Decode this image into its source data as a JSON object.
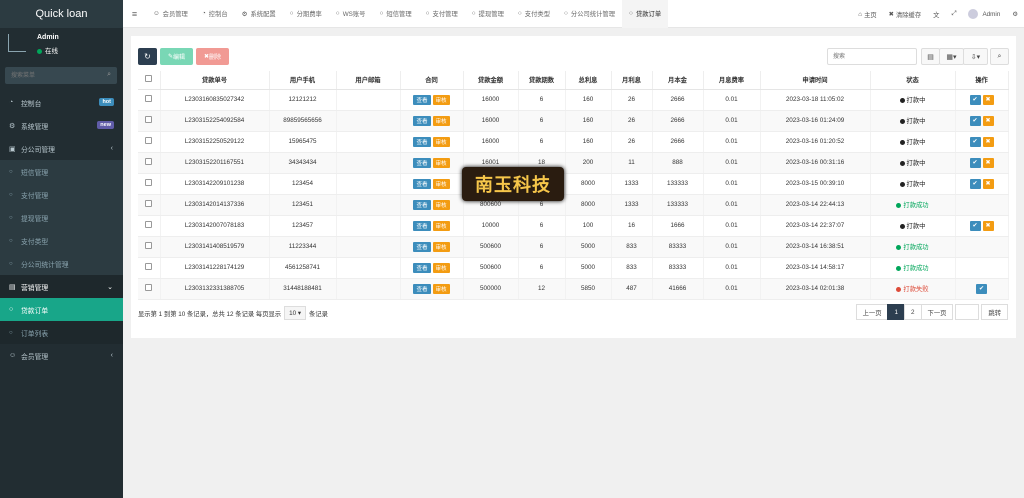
{
  "app": {
    "title": "Quick loan"
  },
  "user": {
    "name": "Admin",
    "status": "在线"
  },
  "sidebar": {
    "search_placeholder": "搜索菜单",
    "items": [
      {
        "label": "控制台",
        "icon": "dashboard-icon",
        "badge": "hot",
        "badge_color": "#3c8dbc"
      },
      {
        "label": "系统管理",
        "icon": "cogs-icon",
        "badge": "new",
        "badge_color": "#605ca8"
      },
      {
        "label": "分公司管理",
        "icon": "building-icon",
        "chevron": "‹"
      },
      {
        "label": "短信管理",
        "sub": true
      },
      {
        "label": "支付管理",
        "sub": true
      },
      {
        "label": "提现管理",
        "sub": true
      },
      {
        "label": "支付类型",
        "sub": true
      },
      {
        "label": "分公司统计管理",
        "sub": true
      },
      {
        "label": "营销管理",
        "icon": "marketing-icon",
        "open": true
      },
      {
        "label": "贷款订单",
        "sub": true,
        "active": true
      },
      {
        "label": "订单列表",
        "sub": true
      },
      {
        "label": "会员管理",
        "icon": "users-icon",
        "chevron": "‹"
      }
    ]
  },
  "topbar": {
    "tabs": [
      {
        "label": "会员管理",
        "icon": "user-icon"
      },
      {
        "label": "控制台",
        "icon": "dashboard-icon"
      },
      {
        "label": "系统配置",
        "icon": "gear-icon"
      },
      {
        "label": "分期费率",
        "icon": "circle-icon"
      },
      {
        "label": "WS账号",
        "icon": "circle-icon"
      },
      {
        "label": "短信管理",
        "icon": "circle-icon"
      },
      {
        "label": "支付管理",
        "icon": "circle-icon"
      },
      {
        "label": "提现管理",
        "icon": "circle-icon"
      },
      {
        "label": "支付类型",
        "icon": "circle-icon"
      },
      {
        "label": "分公司统计管理",
        "icon": "circle-icon"
      },
      {
        "label": "贷款订单",
        "icon": "circle-icon",
        "active": true
      }
    ],
    "right": {
      "home": "主页",
      "clear_cache": "清除缓存",
      "admin": "Admin"
    }
  },
  "toolbar": {
    "edit": "编辑",
    "delete": "删除",
    "search_placeholder": "搜索"
  },
  "table": {
    "headers": [
      "贷款单号",
      "用户手机",
      "用户邮箱",
      "合同",
      "贷款金额",
      "贷款期数",
      "总利息",
      "月利息",
      "月本金",
      "月息费率",
      "申请时间",
      "状态",
      "操作"
    ],
    "contract_buttons": {
      "view": "查看",
      "review": "审核"
    },
    "rows": [
      {
        "no": "L2303160835027342",
        "phone": "12121212",
        "email": "",
        "amount": "16000",
        "periods": "6",
        "interest": "160",
        "monthly_interest": "26",
        "monthly_principal": "2666",
        "rate": "0.01",
        "time": "2023-03-18 11:05:02",
        "status": "打款中",
        "status_color": "#222",
        "ops": 2
      },
      {
        "no": "L2303152254092584",
        "phone": "89859565656",
        "email": "",
        "amount": "16000",
        "periods": "6",
        "interest": "160",
        "monthly_interest": "26",
        "monthly_principal": "2666",
        "rate": "0.01",
        "time": "2023-03-16 01:24:09",
        "status": "打款中",
        "status_color": "#222",
        "ops": 2
      },
      {
        "no": "L2303152250529122",
        "phone": "15965475",
        "email": "",
        "amount": "16000",
        "periods": "6",
        "interest": "160",
        "monthly_interest": "26",
        "monthly_principal": "2666",
        "rate": "0.01",
        "time": "2023-03-16 01:20:52",
        "status": "打款中",
        "status_color": "#222",
        "ops": 2
      },
      {
        "no": "L2303152201167551",
        "phone": "34343434",
        "email": "",
        "amount": "16001",
        "periods": "18",
        "interest": "200",
        "monthly_interest": "11",
        "monthly_principal": "888",
        "rate": "0.01",
        "time": "2023-03-16 00:31:16",
        "status": "打款中",
        "status_color": "#222",
        "ops": 2
      },
      {
        "no": "L2303142209101238",
        "phone": "123454",
        "email": "",
        "amount": "800000",
        "periods": "6",
        "interest": "8000",
        "monthly_interest": "1333",
        "monthly_principal": "133333",
        "rate": "0.01",
        "time": "2023-03-15 00:39:10",
        "status": "打款中",
        "status_color": "#222",
        "ops": 2
      },
      {
        "no": "L2303142014137336",
        "phone": "123451",
        "email": "",
        "amount": "800600",
        "periods": "6",
        "interest": "8000",
        "monthly_interest": "1333",
        "monthly_principal": "133333",
        "rate": "0.01",
        "time": "2023-03-14 22:44:13",
        "status": "打款成功",
        "status_color": "#00a65a",
        "ops": 0
      },
      {
        "no": "L2303142007078183",
        "phone": "123457",
        "email": "",
        "amount": "10000",
        "periods": "6",
        "interest": "100",
        "monthly_interest": "16",
        "monthly_principal": "1666",
        "rate": "0.01",
        "time": "2023-03-14 22:37:07",
        "status": "打款中",
        "status_color": "#222",
        "ops": 2
      },
      {
        "no": "L2303141408519579",
        "phone": "11223344",
        "email": "",
        "amount": "500600",
        "periods": "6",
        "interest": "5000",
        "monthly_interest": "833",
        "monthly_principal": "83333",
        "rate": "0.01",
        "time": "2023-03-14 16:38:51",
        "status": "打款成功",
        "status_color": "#00a65a",
        "ops": 0
      },
      {
        "no": "L2303141228174129",
        "phone": "4561258741",
        "email": "",
        "amount": "500600",
        "periods": "6",
        "interest": "5000",
        "monthly_interest": "833",
        "monthly_principal": "83333",
        "rate": "0.01",
        "time": "2023-03-14 14:58:17",
        "status": "打款成功",
        "status_color": "#00a65a",
        "ops": 0
      },
      {
        "no": "L2303132331388705",
        "phone": "31448188481",
        "email": "",
        "amount": "500000",
        "periods": "12",
        "interest": "5850",
        "monthly_interest": "487",
        "monthly_principal": "41666",
        "rate": "0.01",
        "time": "2023-03-14 02:01:38",
        "status": "打款失败",
        "status_color": "#dd4b39",
        "ops": 1
      }
    ]
  },
  "footer": {
    "summary_prefix": "显示第 1 到第 10 条记录，总共 12 条记录 每页显示",
    "page_size": "10",
    "summary_suffix": "条记录",
    "prev": "上一页",
    "pages": [
      "1",
      "2"
    ],
    "next": "下一页",
    "goto": "跳转"
  },
  "watermark": {
    "text": "南玉科技"
  }
}
